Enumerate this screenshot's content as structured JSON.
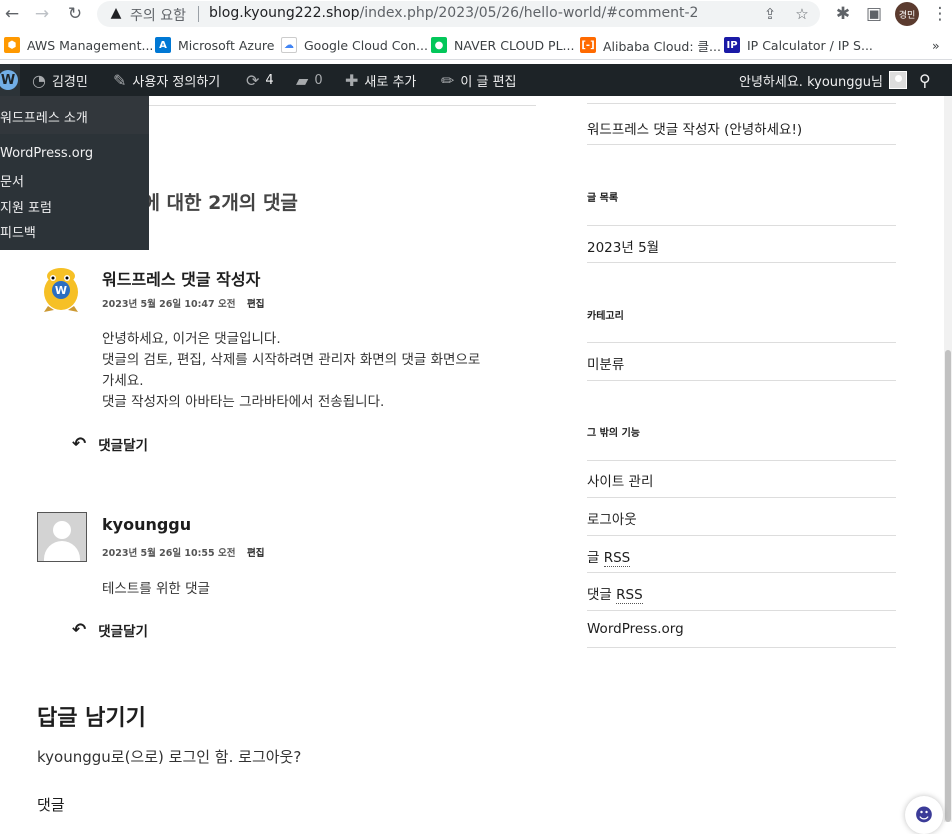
{
  "browser": {
    "security_label": "주의 요함",
    "url_host": "blog.kyoung222.shop",
    "url_path": "/index.php/2023/05/26/hello-world/#comment-2",
    "profile_initials": "경민",
    "more_bookmarks": "»"
  },
  "bookmarks": [
    {
      "label": "AWS Management...",
      "color": "#ff9900"
    },
    {
      "label": "Microsoft Azure",
      "color": "#0078d4"
    },
    {
      "label": "Google Cloud Con...",
      "color": "#4285f4"
    },
    {
      "label": "NAVER CLOUD PL...",
      "color": "#03c75a"
    },
    {
      "label": "Alibaba Cloud: 클...",
      "color": "#ff6a00"
    },
    {
      "label": "IP Calculator / IP S...",
      "color": "#1a1aa6"
    }
  ],
  "adminbar": {
    "site_name": "김경민",
    "customize": "사용자 정의하기",
    "updates_count": "4",
    "comments_count": "0",
    "new": "새로 추가",
    "edit_post": "이 글 편집",
    "greeting": "안녕하세요. kyounggu님"
  },
  "wp_menu": {
    "about": "워드프레스 소개",
    "items": [
      "WordPress.org",
      "문서",
      "지원 포럼",
      "피드백"
    ]
  },
  "post": {
    "comments_title": "”에 대한 2개의 댓글",
    "comments": [
      {
        "author": "워드프레스 댓글 작성자",
        "date": "2023년 5월 26일 10:47 오전",
        "edit": "편집",
        "lines": [
          "안녕하세요, 이거은 댓글입니다.",
          "댓글의 검토, 편집, 삭제를 시작하려면 관리자 화면의 댓글 화면으로",
          "가세요.",
          "댓글 작성자의 아바타는 그라바타에서 전송됩니다."
        ],
        "reply": "댓글달기"
      },
      {
        "author": "kyounggu",
        "date": "2023년 5월 26일 10:55 오전",
        "edit": "편집",
        "lines": [
          "테스트를 위한 댓글"
        ],
        "reply": "댓글달기"
      }
    ],
    "respond_title": "답글 남기기",
    "logged_in_text": "kyounggu로(으로) 로그인 함. 로그아웃?",
    "comment_label": "댓글"
  },
  "sidebar": {
    "recent_comment": "워드프레스 댓글 작성자 (안녕하세요!)",
    "archives_title": "글 목록",
    "archive_item": "2023년 5월",
    "categories_title": "카테고리",
    "category_item": "미분류",
    "meta_title": "그 밖의 기능",
    "meta_items": {
      "site_admin": "사이트 관리",
      "logout": "로그아웃",
      "entries_prefix": "글 ",
      "comments_prefix": "댓글 ",
      "rss": "RSS",
      "wporg": "WordPress.org"
    }
  }
}
